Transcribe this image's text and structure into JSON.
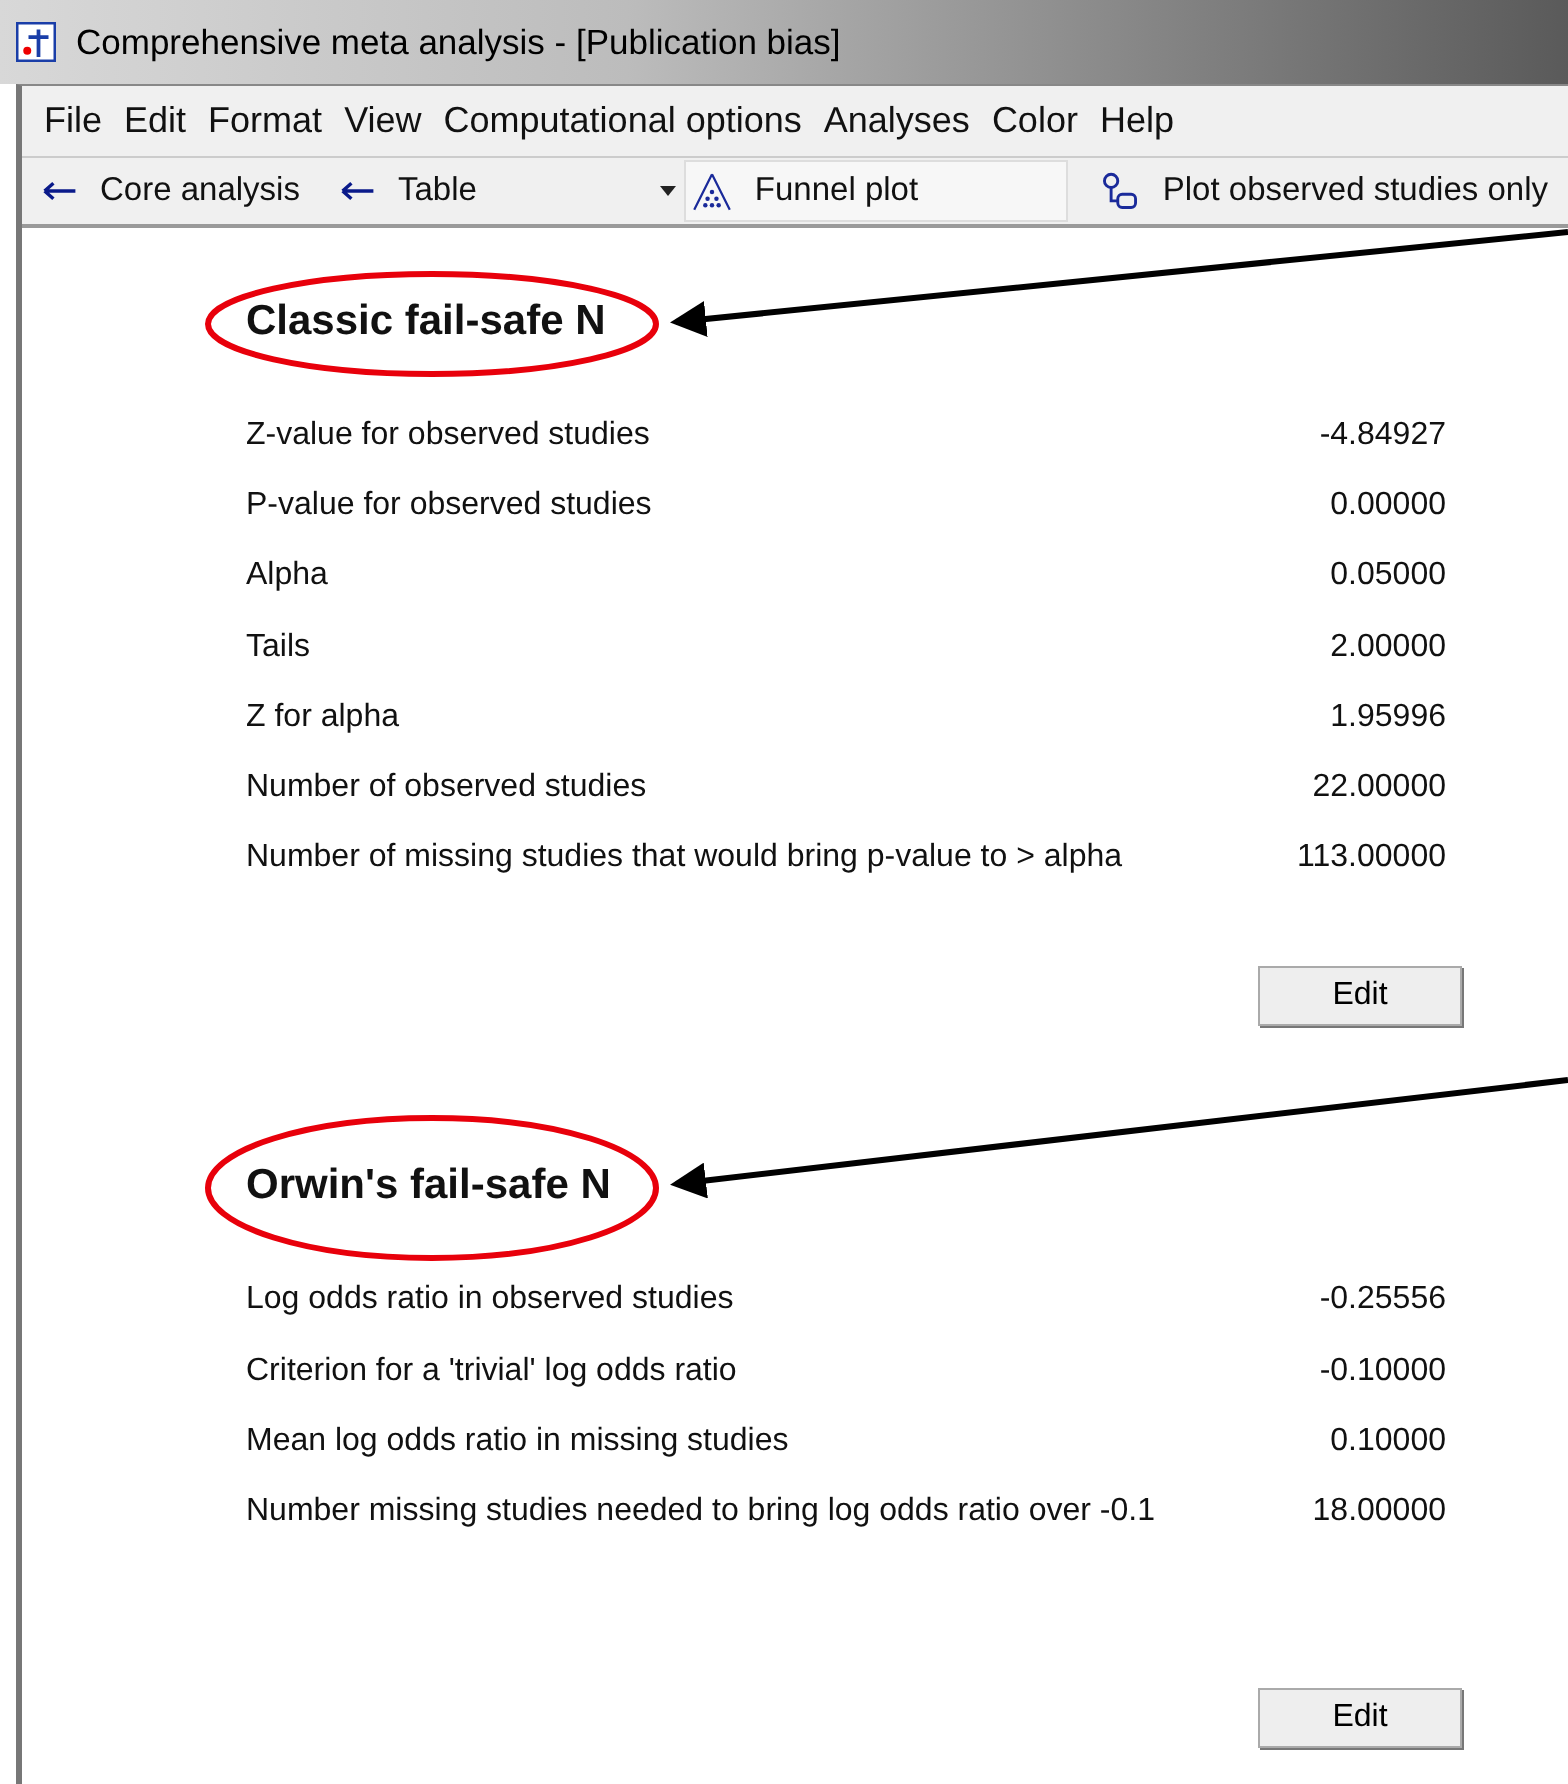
{
  "window": {
    "title": "Comprehensive meta analysis - [Publication bias]"
  },
  "menu": [
    "File",
    "Edit",
    "Format",
    "View",
    "Computational options",
    "Analyses",
    "Color",
    "Help"
  ],
  "toolbar": [
    {
      "kind": "back",
      "label": "Core analysis"
    },
    {
      "kind": "back",
      "label": "Table"
    },
    {
      "kind": "dropdown",
      "label": "Funnel plot"
    },
    {
      "kind": "toggle",
      "label": "Plot observed studies only"
    }
  ],
  "sections": [
    {
      "title": "Classic fail-safe N",
      "rows": [
        {
          "label": "Z-value for observed studies",
          "value": "-4.84927"
        },
        {
          "label": "P-value for observed studies",
          "value": "0.00000"
        },
        {
          "label": "Alpha",
          "value": "0.05000"
        },
        {
          "label": "Tails",
          "value": "2.00000"
        },
        {
          "label": "Z for alpha",
          "value": "1.95996"
        },
        {
          "label": "Number of observed studies",
          "value": "22.00000"
        },
        {
          "label": "Number of missing studies that would bring p-value to > alpha",
          "value": "113.00000"
        }
      ],
      "button": "Edit"
    },
    {
      "title": "Orwin's fail-safe N",
      "rows": [
        {
          "label": "Log odds ratio in observed studies",
          "value": "-0.25556"
        },
        {
          "label": "Criterion for a 'trivial' log odds ratio",
          "value": "-0.10000"
        },
        {
          "label": "Mean log odds ratio in missing studies",
          "value": "0.10000"
        },
        {
          "label": "Number missing studies needed to bring log odds ratio over -0.1",
          "value": "18.00000"
        }
      ],
      "button": "Edit"
    }
  ]
}
